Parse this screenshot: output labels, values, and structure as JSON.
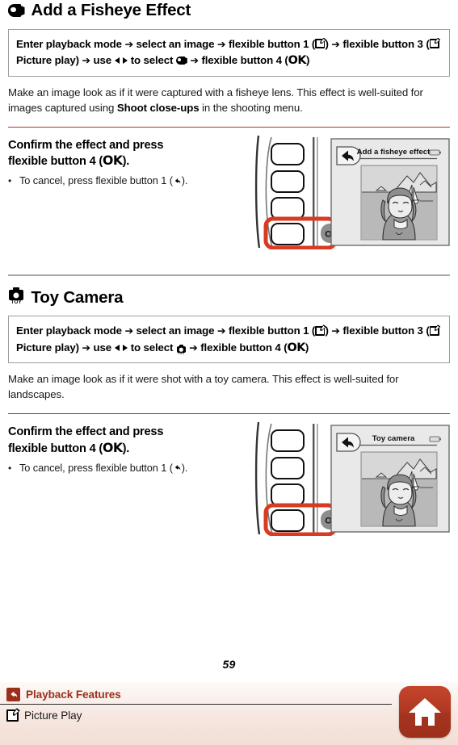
{
  "sections": [
    {
      "id": "fisheye",
      "icon": "fish-icon",
      "title": "Add a Fisheye Effect",
      "instruction": {
        "part1": "Enter playback mode",
        "part2": "select an image",
        "part3": "flexible button 1 (",
        "part4": ")",
        "part5": "flexible button 3 (",
        "part6": "Picture play)",
        "part7": "use",
        "part8": "to select",
        "part9": "flexible button 4 (",
        "part10": "OK",
        "part11": ")",
        "arrow": "➔",
        "select_icon": "fish-icon"
      },
      "description_pre": "Make an image look as if it were captured with a fisheye lens. This effect is well-suited for images captured using ",
      "description_bold": "Shoot close-ups",
      "description_post": " in the shooting menu.",
      "subheading_line1": "Confirm the effect and press",
      "subheading_line2_pre": "flexible button 4 (",
      "subheading_ok": "OK",
      "subheading_line2_post": ").",
      "bullet_pre": "To cancel, press flexible button 1 (",
      "bullet_post": ").",
      "screen_title": "Add a fisheye effect",
      "ok_label": "OK"
    },
    {
      "id": "toycamera",
      "icon": "toy-camera-icon",
      "title": "Toy Camera",
      "instruction": {
        "part1": "Enter playback mode",
        "part2": "select an image",
        "part3": "flexible button 1 (",
        "part4": ")",
        "part5": "flexible button 3 (",
        "part6": "Picture play)",
        "part7": "use",
        "part8": "to select",
        "part9": "flexible button 4 (",
        "part10": "OK",
        "part11": ")",
        "arrow": "➔",
        "select_icon": "toy-camera-icon"
      },
      "description_pre": "Make an image look as if it were shot with a toy camera. This effect is well-suited for landscapes.",
      "description_bold": "",
      "description_post": "",
      "subheading_line1": "Confirm the effect and press",
      "subheading_line2_pre": "flexible button 4 (",
      "subheading_ok": "OK",
      "subheading_line2_post": ").",
      "bullet_pre": "To cancel, press flexible button 1 (",
      "bullet_post": ").",
      "screen_title": "Toy camera",
      "ok_label": "OK"
    }
  ],
  "page_number": "59",
  "footer": {
    "breadcrumb_1": "Playback Features",
    "breadcrumb_2": "Picture Play",
    "home_icon": "home-icon",
    "back_icon": "back-arrow-icon",
    "picture_play_icon": "picture-play-icon"
  },
  "colors": {
    "accent_red": "#9c2f1c",
    "rule_red": "#a33a25",
    "rule_gray": "#a8a8a8",
    "highlight_red": "#d93b22",
    "box_border": "#9d9d9d"
  }
}
